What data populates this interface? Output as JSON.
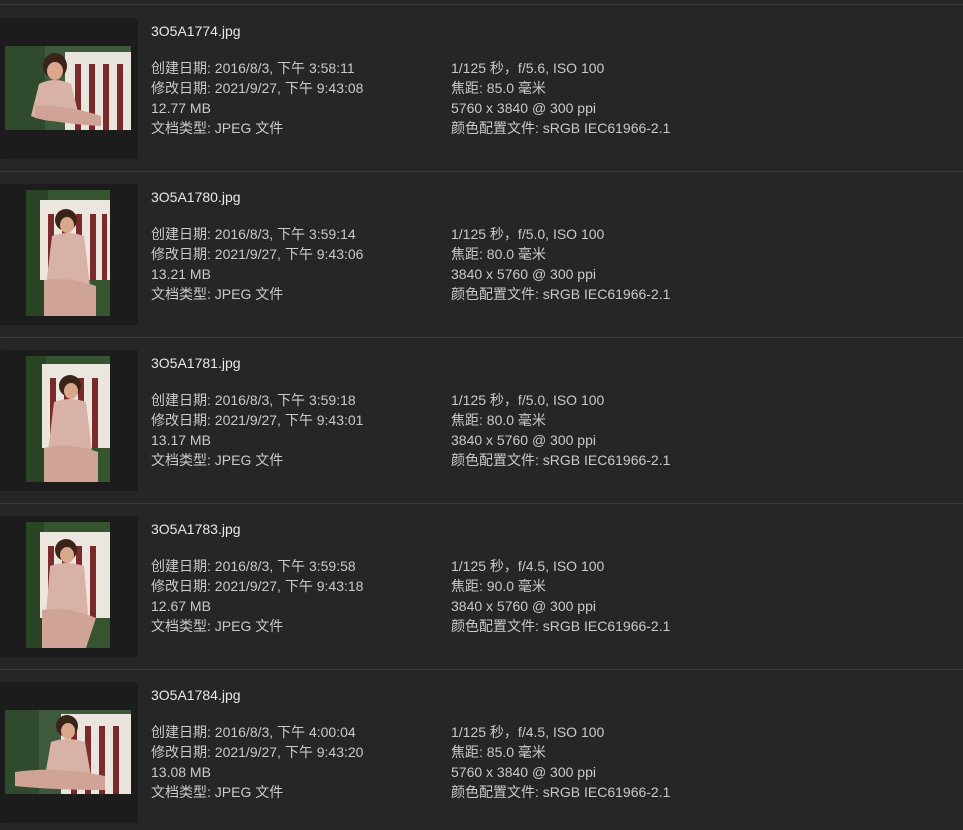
{
  "files": [
    {
      "filename": "3O5A1774.jpg",
      "orientation": "landscape",
      "created": "创建日期: 2016/8/3, 下午 3:58:11",
      "modified": "修改日期: 2021/9/27, 下午 9:43:08",
      "size": "12.77 MB",
      "kind": "文档类型: JPEG 文件",
      "exposure": "1/125 秒，f/5.6, ISO 100",
      "focal": "焦距: 85.0 毫米",
      "dimensions": "5760 x 3840 @ 300 ppi",
      "profile": "颜色配置文件: sRGB IEC61966-2.1"
    },
    {
      "filename": "3O5A1780.jpg",
      "orientation": "portrait",
      "created": "创建日期: 2016/8/3, 下午 3:59:14",
      "modified": "修改日期: 2021/9/27, 下午 9:43:06",
      "size": "13.21 MB",
      "kind": "文档类型: JPEG 文件",
      "exposure": "1/125 秒，f/5.0, ISO 100",
      "focal": "焦距: 80.0 毫米",
      "dimensions": "3840 x 5760 @ 300 ppi",
      "profile": "颜色配置文件: sRGB IEC61966-2.1"
    },
    {
      "filename": "3O5A1781.jpg",
      "orientation": "portrait",
      "created": "创建日期: 2016/8/3, 下午 3:59:18",
      "modified": "修改日期: 2021/9/27, 下午 9:43:01",
      "size": "13.17 MB",
      "kind": "文档类型: JPEG 文件",
      "exposure": "1/125 秒，f/5.0, ISO 100",
      "focal": "焦距: 80.0 毫米",
      "dimensions": "3840 x 5760 @ 300 ppi",
      "profile": "颜色配置文件: sRGB IEC61966-2.1"
    },
    {
      "filename": "3O5A1783.jpg",
      "orientation": "portrait",
      "created": "创建日期: 2016/8/3, 下午 3:59:58",
      "modified": "修改日期: 2021/9/27, 下午 9:43:18",
      "size": "12.67 MB",
      "kind": "文档类型: JPEG 文件",
      "exposure": "1/125 秒，f/4.5, ISO 100",
      "focal": "焦距: 90.0 毫米",
      "dimensions": "3840 x 5760 @ 300 ppi",
      "profile": "颜色配置文件: sRGB IEC61966-2.1"
    },
    {
      "filename": "3O5A1784.jpg",
      "orientation": "landscape",
      "created": "创建日期: 2016/8/3, 下午 4:00:04",
      "modified": "修改日期: 2021/9/27, 下午 9:43:20",
      "size": "13.08 MB",
      "kind": "文档类型: JPEG 文件",
      "exposure": "1/125 秒，f/4.5, ISO 100",
      "focal": "焦距: 85.0 毫米",
      "dimensions": "5760 x 3840 @ 300 ppi",
      "profile": "颜色配置文件: sRGB IEC61966-2.1"
    }
  ],
  "colors": {
    "background": "#262627",
    "thumb_frame": "#1c1c1d",
    "divider": "#3a3a3b",
    "text_primary": "#e8e8e8",
    "text_secondary": "#c9c9c9"
  }
}
